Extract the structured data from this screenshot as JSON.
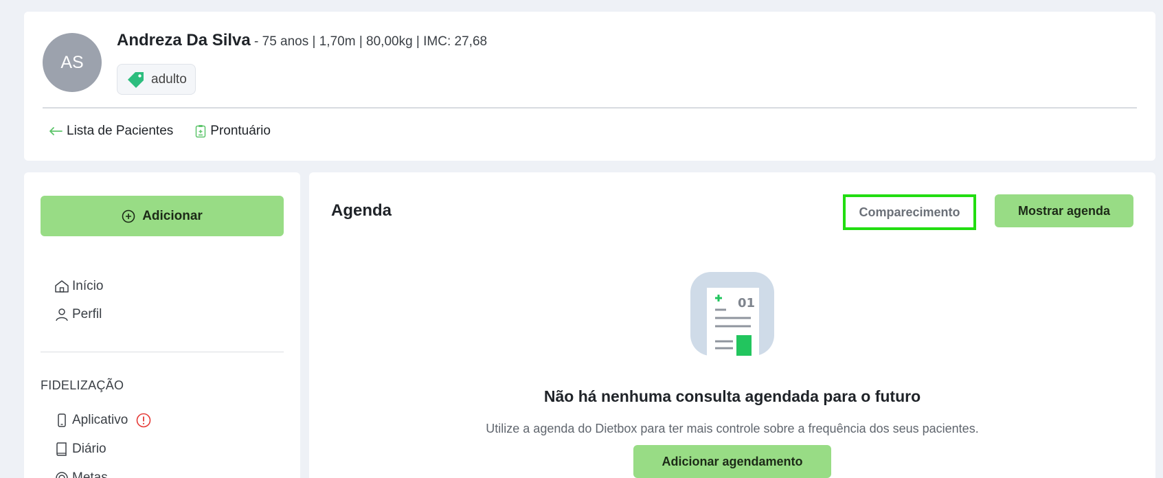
{
  "patient": {
    "initials": "AS",
    "name": "Andreza Da Silva",
    "meta": " - 75 anos | 1,70m | 80,00kg | IMC: 27,68",
    "tag": "adulto"
  },
  "nav": {
    "back_label": "Lista de Pacientes",
    "record_label": "Prontuário"
  },
  "sidebar": {
    "add_label": "Adicionar",
    "items": [
      {
        "label": "Início",
        "icon": "home-icon"
      },
      {
        "label": "Perfil",
        "icon": "user-icon"
      }
    ],
    "section_title": "FIDELIZAÇÃO",
    "fidelizacao_items": [
      {
        "label": "Aplicativo",
        "icon": "phone-icon",
        "alert": true
      },
      {
        "label": "Diário",
        "icon": "book-icon"
      },
      {
        "label": "Metas",
        "icon": "target-icon"
      }
    ]
  },
  "agenda": {
    "title": "Agenda",
    "attendance_label": "Comparecimento",
    "show_label": "Mostrar agenda",
    "illustration_number": "01",
    "empty_title": "Não há nenhuma consulta agendada para o futuro",
    "empty_subtitle": "Utilize a agenda do Dietbox para ter mais controle sobre a frequência dos seus pacientes.",
    "add_schedule_label": "Adicionar agendamento"
  },
  "colors": {
    "accent_green": "#98dc85",
    "highlight_border": "#22dd11",
    "tag_green": "#2dbd7e",
    "alert_red": "#e53935"
  }
}
